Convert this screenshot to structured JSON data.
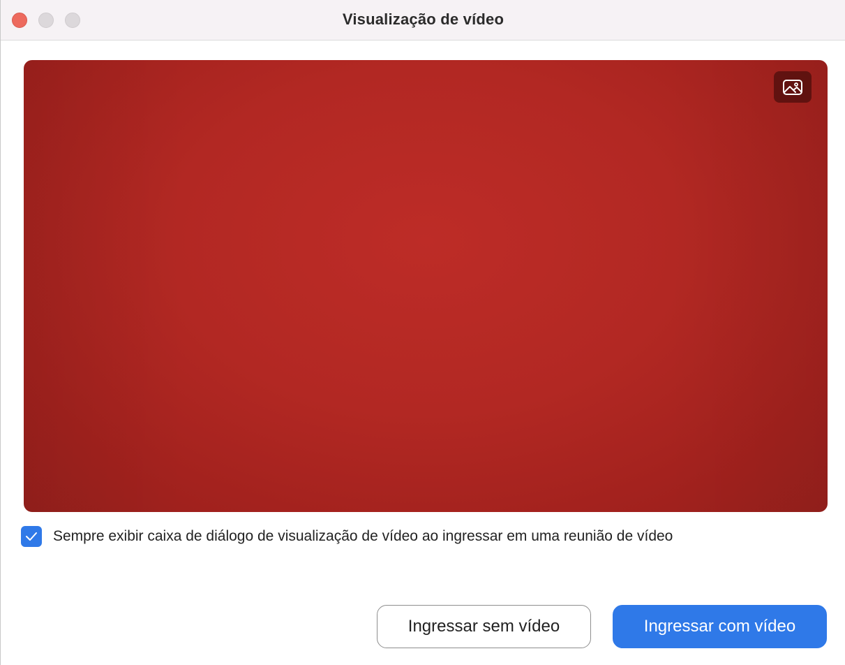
{
  "window": {
    "title": "Visualização de vídeo"
  },
  "preview": {
    "background_color": "#b22823",
    "background_button_icon": "image-icon"
  },
  "options": {
    "always_show_preview_label": "Sempre exibir caixa de diálogo de visualização de vídeo ao ingressar em uma reunião de vídeo",
    "always_show_preview_checked": true
  },
  "actions": {
    "join_without_video_label": "Ingressar sem vídeo",
    "join_with_video_label": "Ingressar com vídeo"
  },
  "colors": {
    "accent": "#2f79e8",
    "close": "#ed6a5e"
  }
}
